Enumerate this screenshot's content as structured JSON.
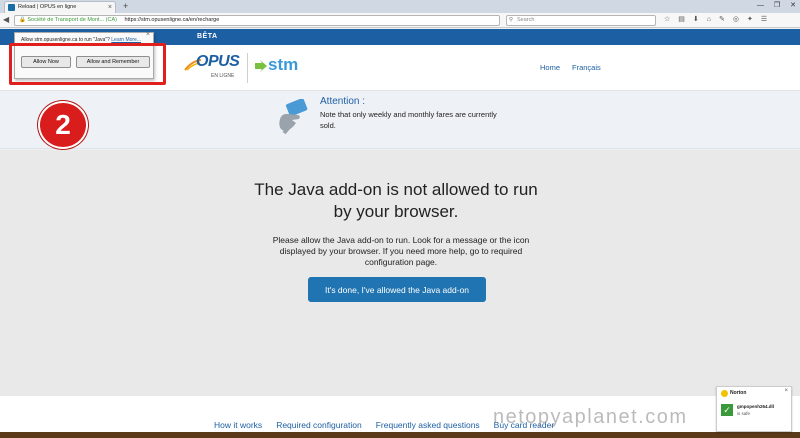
{
  "browser": {
    "tab_title": "Reload | OPUS en ligne",
    "tab_close": "×",
    "new_tab": "+",
    "window_controls": [
      "—",
      "❐",
      "✕"
    ],
    "url_org": "Société de Transport de Mont... (CA)",
    "url_path": "https://stm.opusenligne.ca/en/recharge",
    "search_placeholder": "Search",
    "toolbar_icons": [
      "star-icon",
      "bookmarks-icon",
      "download-icon",
      "home-icon",
      "menu-icon"
    ]
  },
  "java_popup": {
    "message": "Allow stm.opusenligne.ca to run \"Java\"?",
    "learn_more": "Learn More...",
    "close": "×",
    "allow_now": "Allow Now",
    "allow_remember": "Allow and Remember",
    "step_number": "2"
  },
  "site": {
    "beta": "BÊTA",
    "opus_name": "OPUS",
    "opus_sub": "EN LIGNE",
    "stm_name": "stm",
    "nav": [
      "Home",
      "Français"
    ]
  },
  "attention": {
    "title": "Attention :",
    "text": "Note that only weekly and monthly fares are currently sold."
  },
  "main": {
    "headline": "The Java add-on is not allowed to run by your browser.",
    "body": "Please allow the Java add-on to run. Look for a message or the icon displayed by your browser. If you need more help, go to required configuration page.",
    "button": "It's done, I've allowed the Java add-on"
  },
  "footer": {
    "links": [
      "How it works",
      "Required configuration",
      "Frequently asked questions",
      "Buy card reader"
    ]
  },
  "watermark": "netopyaplanet.com",
  "norton": {
    "brand": "Norton",
    "close": "×",
    "file": "gmpopenh264.dll",
    "status": "is safe"
  },
  "colors": {
    "brand_blue": "#1d5fa3",
    "button_blue": "#1f74b1",
    "highlight_red": "#e01f1f",
    "stm_blue": "#3a9ad9"
  }
}
